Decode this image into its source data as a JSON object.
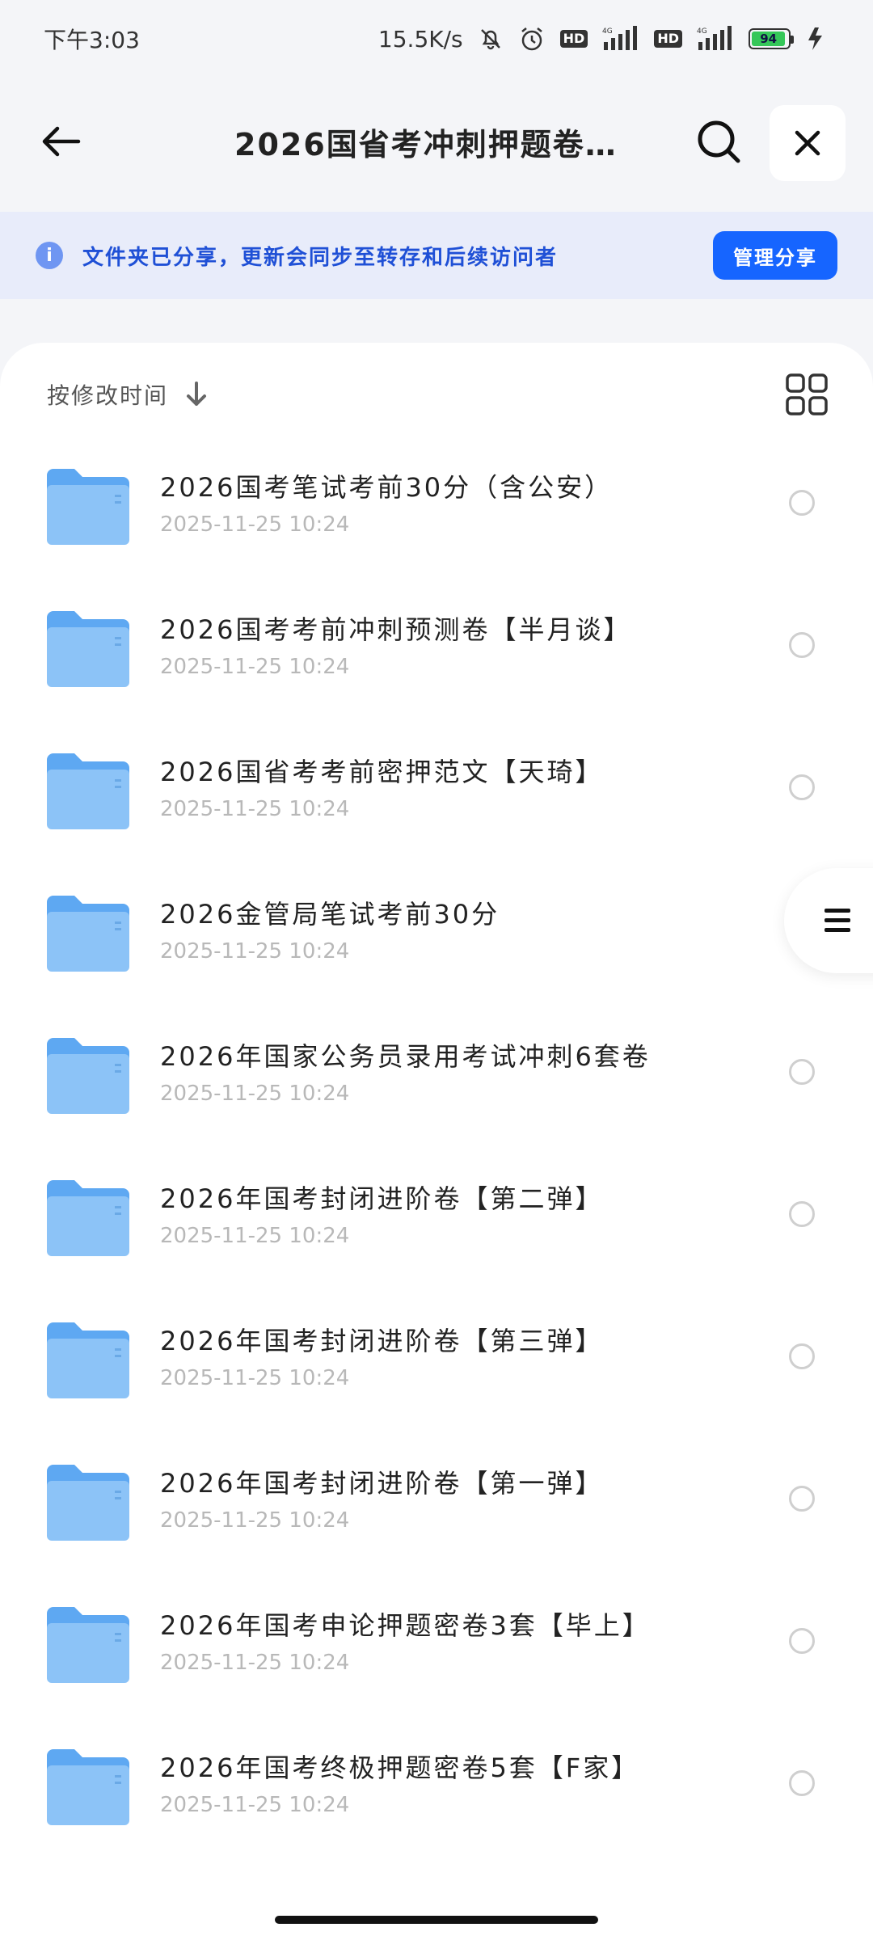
{
  "status_bar": {
    "time": "下午3:03",
    "net_speed": "15.5K/s",
    "hd1": "HD",
    "hd2": "HD",
    "net1": "4G",
    "net2": "4G",
    "battery_level": "94",
    "icons": [
      "bell-off-icon",
      "alarm-icon",
      "signal-icon",
      "battery-icon",
      "charging-icon"
    ]
  },
  "header": {
    "title": "2026国省考冲刺押题卷…",
    "back_icon": "arrow-left-icon",
    "search_icon": "search-icon",
    "close_icon": "close-icon"
  },
  "share_banner": {
    "text": "文件夹已分享，更新会同步至转存和后续访问者",
    "button": "管理分享",
    "accent": "#1665ff"
  },
  "toolbar": {
    "sort_label": "按修改时间",
    "sort_icon": "arrow-down-icon",
    "view_icon": "grid-view-icon"
  },
  "files": [
    {
      "name": "2026国考笔试考前30分（含公安）",
      "date": "2025-11-25  10:24"
    },
    {
      "name": "2026国考考前冲刺预测卷【半月谈】",
      "date": "2025-11-25  10:24"
    },
    {
      "name": "2026国省考考前密押范文【天琦】",
      "date": "2025-11-25  10:24"
    },
    {
      "name": "2026金管局笔试考前30分",
      "date": "2025-11-25  10:24"
    },
    {
      "name": "2026年国家公务员录用考试冲刺6套卷",
      "date": "2025-11-25  10:24"
    },
    {
      "name": "2026年国考封闭进阶卷【第二弹】",
      "date": "2025-11-25  10:24"
    },
    {
      "name": "2026年国考封闭进阶卷【第三弹】",
      "date": "2025-11-25  10:24"
    },
    {
      "name": "2026年国考封闭进阶卷【第一弹】",
      "date": "2025-11-25  10:24"
    },
    {
      "name": "2026年国考申论押题密卷3套【毕上】",
      "date": "2025-11-25  10:24"
    },
    {
      "name": "2026年国考终极押题密卷5套【F家】",
      "date": "2025-11-25  10:24"
    }
  ]
}
